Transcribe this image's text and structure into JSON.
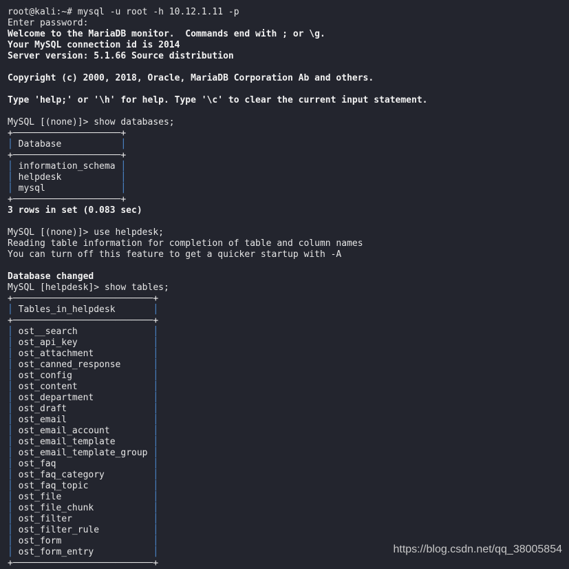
{
  "terminal": {
    "prompt_shell": "root@kali:~# ",
    "command_connect": "mysql -u root -h 10.12.1.11 -p",
    "password_prompt": "Enter password:",
    "banner": [
      "Welcome to the MariaDB monitor.  Commands end with ; or \\g.",
      "Your MySQL connection id is 2014",
      "Server version: 5.1.66 Source distribution"
    ],
    "copyright": "Copyright (c) 2000, 2018, Oracle, MariaDB Corporation Ab and others.",
    "help_text": "Type 'help;' or '\\h' for help. Type '\\c' to clear the current input statement.",
    "prompt_none": "MySQL [(none)]> ",
    "cmd_show_databases": "show databases;",
    "databases_table": {
      "header": "Database",
      "rows": [
        "information_schema",
        "helpdesk",
        "mysql"
      ]
    },
    "rows_result": "3 rows in set (0.083 sec)",
    "cmd_use": "use helpdesk;",
    "reading_info": [
      "Reading table information for completion of table and column names",
      "You can turn off this feature to get a quicker startup with -A"
    ],
    "db_changed": "Database changed",
    "prompt_helpdesk": "MySQL [helpdesk]> ",
    "cmd_show_tables": "show tables;",
    "tables_table": {
      "header": "Tables_in_helpdesk",
      "rows": [
        "ost__search",
        "ost_api_key",
        "ost_attachment",
        "ost_canned_response",
        "ost_config",
        "ost_content",
        "ost_department",
        "ost_draft",
        "ost_email",
        "ost_email_account",
        "ost_email_template",
        "ost_email_template_group",
        "ost_faq",
        "ost_faq_category",
        "ost_faq_topic",
        "ost_file",
        "ost_file_chunk",
        "ost_filter",
        "ost_filter_rule",
        "ost_form",
        "ost_form_entry"
      ]
    }
  },
  "watermark": "https://blog.csdn.net/qq_38005854",
  "colors": {
    "background": "#23252e",
    "text": "#e6e6e6",
    "table_border": "#4f8fd6"
  }
}
